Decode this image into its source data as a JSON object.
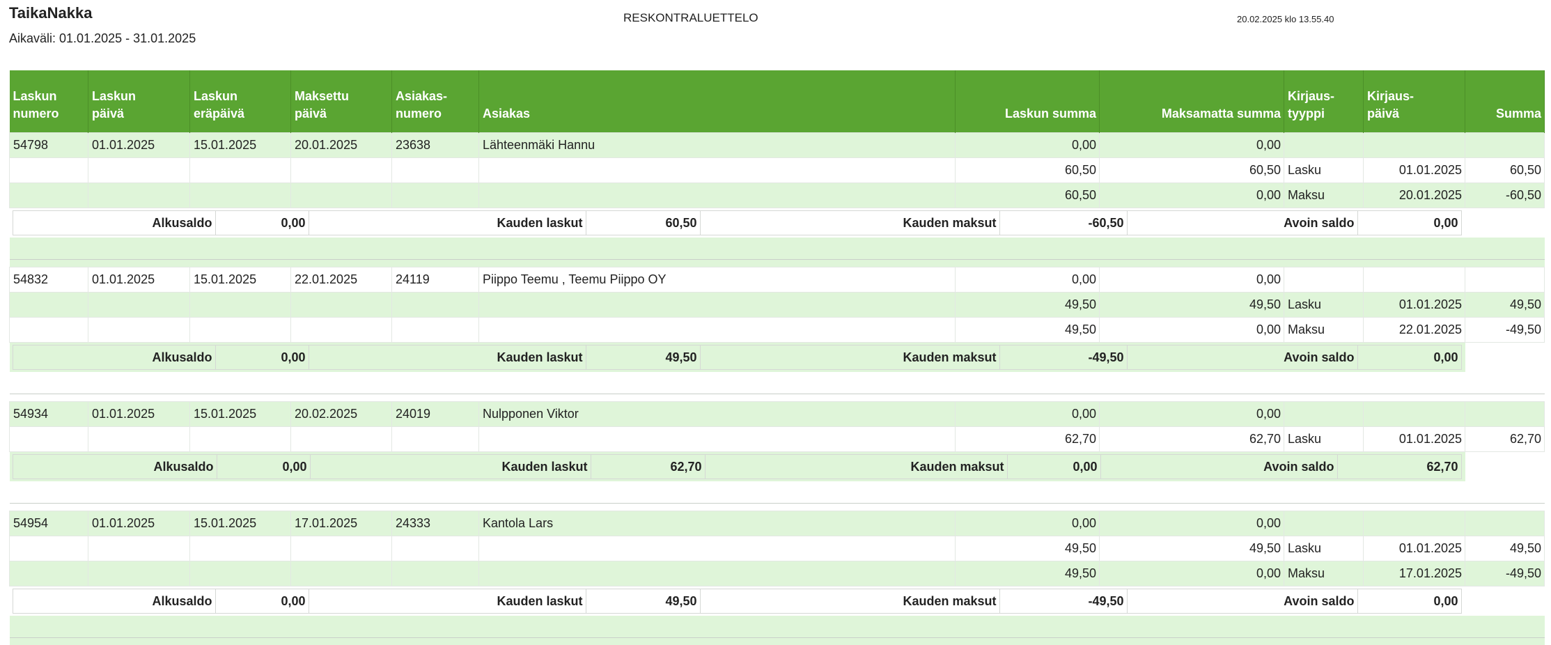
{
  "header": {
    "company": "TaikaNakka",
    "period": "Aikaväli: 01.01.2025 - 31.01.2025",
    "title": "RESKONTRALUETTELO",
    "printed": "20.02.2025 klo 13.55.40"
  },
  "columns": [
    {
      "line1": "Laskun",
      "line2": "numero"
    },
    {
      "line1": "Laskun",
      "line2": "päivä"
    },
    {
      "line1": "Laskun",
      "line2": "eräpäivä"
    },
    {
      "line1": "Maksettu",
      "line2": "päivä"
    },
    {
      "line1": "Asiakas-",
      "line2": "numero"
    },
    {
      "line1": "",
      "line2": "Asiakas"
    },
    {
      "line1": "",
      "line2": "Laskun summa"
    },
    {
      "line1": "",
      "line2": "Maksamatta summa"
    },
    {
      "line1": "Kirjaus-",
      "line2": "tyyppi"
    },
    {
      "line1": "Kirjaus-",
      "line2": "päivä"
    },
    {
      "line1": "",
      "line2": "Summa"
    }
  ],
  "summary_labels": {
    "start": "Alkusaldo",
    "invoices": "Kauden laskut",
    "payments": "Kauden maksut",
    "open": "Avoin saldo"
  },
  "invoices": [
    {
      "number": "54798",
      "date": "01.01.2025",
      "due": "15.01.2025",
      "paid": "20.01.2025",
      "customer_no": "23638",
      "customer": "Lähteenmäki Hannu",
      "amount": "0,00",
      "unpaid": "0,00",
      "entries": [
        {
          "amount": "60,50",
          "unpaid": "60,50",
          "type": "Lasku",
          "date": "01.01.2025",
          "sum": "60,50"
        },
        {
          "amount": "60,50",
          "unpaid": "0,00",
          "type": "Maksu",
          "date": "20.01.2025",
          "sum": "-60,50"
        }
      ],
      "summary": {
        "start": "0,00",
        "invoices": "60,50",
        "payments": "-60,50",
        "open": "0,00"
      }
    },
    {
      "number": "54832",
      "date": "01.01.2025",
      "due": "15.01.2025",
      "paid": "22.01.2025",
      "customer_no": "24119",
      "customer": "Piippo Teemu , Teemu Piippo OY",
      "amount": "0,00",
      "unpaid": "0,00",
      "entries": [
        {
          "amount": "49,50",
          "unpaid": "49,50",
          "type": "Lasku",
          "date": "01.01.2025",
          "sum": "49,50"
        },
        {
          "amount": "49,50",
          "unpaid": "0,00",
          "type": "Maksu",
          "date": "22.01.2025",
          "sum": "-49,50"
        }
      ],
      "summary": {
        "start": "0,00",
        "invoices": "49,50",
        "payments": "-49,50",
        "open": "0,00"
      }
    },
    {
      "number": "54934",
      "date": "01.01.2025",
      "due": "15.01.2025",
      "paid": "20.02.2025",
      "customer_no": "24019",
      "customer": "Nulpponen Viktor",
      "amount": "0,00",
      "unpaid": "0,00",
      "entries": [
        {
          "amount": "62,70",
          "unpaid": "62,70",
          "type": "Lasku",
          "date": "01.01.2025",
          "sum": "62,70"
        }
      ],
      "summary": {
        "start": "0,00",
        "invoices": "62,70",
        "payments": "0,00",
        "open": "62,70"
      }
    },
    {
      "number": "54954",
      "date": "01.01.2025",
      "due": "15.01.2025",
      "paid": "17.01.2025",
      "customer_no": "24333",
      "customer": "Kantola Lars",
      "amount": "0,00",
      "unpaid": "0,00",
      "entries": [
        {
          "amount": "49,50",
          "unpaid": "49,50",
          "type": "Lasku",
          "date": "01.01.2025",
          "sum": "49,50"
        },
        {
          "amount": "49,50",
          "unpaid": "0,00",
          "type": "Maksu",
          "date": "17.01.2025",
          "sum": "-49,50"
        }
      ],
      "summary": {
        "start": "0,00",
        "invoices": "49,50",
        "payments": "-49,50",
        "open": "0,00"
      }
    }
  ]
}
